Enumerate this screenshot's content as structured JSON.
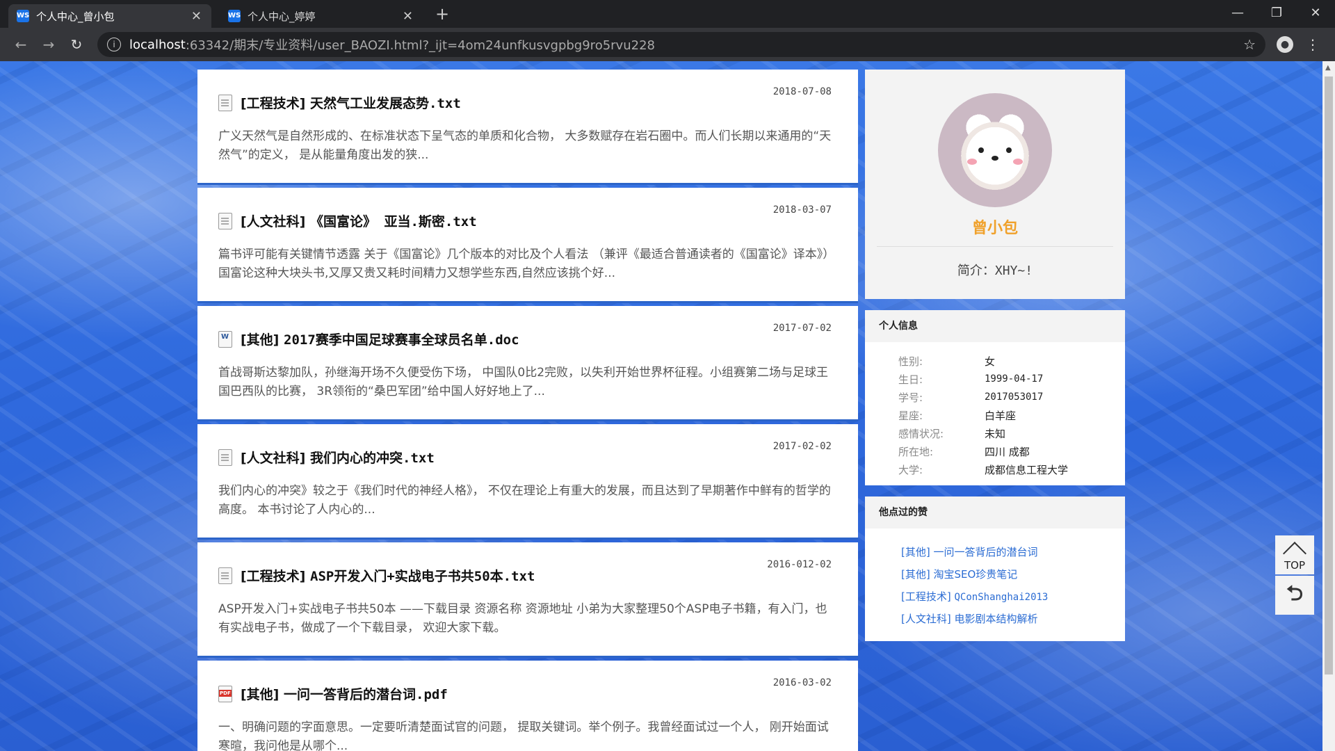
{
  "browser": {
    "tabs": [
      {
        "title": "个人中心_曾小包",
        "favicon": "WS",
        "active": true
      },
      {
        "title": "个人中心_婷婷",
        "favicon": "WS",
        "active": false
      }
    ],
    "url_host": "localhost",
    "url_path": ":63342/期末/专业资料/user_BAOZI.html?_ijt=4om24unfkusvgpbg9ro5rvu228"
  },
  "feed": {
    "items": [
      {
        "date": "2018-07-08",
        "category": "[工程技术]",
        "name": "天然气工业发展态势.txt",
        "filetype": "txt",
        "desc": "广义天然气是自然形成的、在标准状态下呈气态的单质和化合物， 大多数赋存在岩石圈中。而人们长期以来通用的“天然气”的定义， 是从能量角度出发的狭..."
      },
      {
        "date": "2018-03-07",
        "category": "[人文社科]",
        "name": "《国富论》 亚当.斯密.txt",
        "filetype": "txt",
        "desc": "篇书评可能有关键情节透露 关于《国富论》几个版本的对比及个人看法 （兼评《最适合普通读者的《国富论》译本》） 国富论这种大块头书,又厚又贵又耗时间精力又想学些东西,自然应该挑个好..."
      },
      {
        "date": "2017-07-02",
        "category": "[其他]",
        "name": "2017赛季中国足球赛事全球员名单.doc",
        "filetype": "doc",
        "desc": "首战哥斯达黎加队，孙继海开场不久便受伤下场， 中国队0比2完败，以失利开始世界杯征程。小组赛第二场与足球王国巴西队的比赛， 3R领衔的“桑巴军团”给中国人好好地上了..."
      },
      {
        "date": "2017-02-02",
        "category": "[人文社科]",
        "name": "我们内心的冲突.txt",
        "filetype": "txt",
        "desc": "我们内心的冲突》较之于《我们时代的神经人格》， 不仅在理论上有重大的发展，而且达到了早期著作中鲜有的哲学的高度。 本书讨论了人内心的..."
      },
      {
        "date": "2016-012-02",
        "category": "[工程技术]",
        "name": "ASP开发入门+实战电子书共50本.txt",
        "filetype": "txt",
        "desc": "ASP开发入门+实战电子书共50本 ——下载目录 资源名称 资源地址 小弟为大家整理50个ASP电子书籍，有入门，也有实战电子书，做成了一个下载目录， 欢迎大家下载。"
      },
      {
        "date": "2016-03-02",
        "category": "[其他]",
        "name": "一问一答背后的潜台词.pdf",
        "filetype": "pdf",
        "desc": "一、明确问题的字面意思。一定要听清楚面试官的问题， 提取关键词。举个例子。我曾经面试过一个人， 刚开始面试寒暄，我问他是从哪个..."
      }
    ]
  },
  "profile": {
    "name": "曾小包",
    "bio_label": "简介：",
    "bio_value": "XHY~!"
  },
  "personal_info": {
    "header": "个人信息",
    "rows": [
      {
        "k": "性别:",
        "v": "女"
      },
      {
        "k": "生日:",
        "v": "1999-04-17"
      },
      {
        "k": "学号:",
        "v": "2017053017"
      },
      {
        "k": "星座:",
        "v": "白羊座"
      },
      {
        "k": "感情状况:",
        "v": "未知"
      },
      {
        "k": "所在地:",
        "v": "四川 成都"
      },
      {
        "k": "大学:",
        "v": "成都信息工程大学"
      }
    ]
  },
  "likes": {
    "header": "他点过的赞",
    "items": [
      {
        "cat": "[其他]",
        "title": "一问一答背后的潜台词"
      },
      {
        "cat": "[其他]",
        "title": "淘宝SEO珍贵笔记"
      },
      {
        "cat": "[工程技术]",
        "title": "QConShanghai2013"
      },
      {
        "cat": "[人文社科]",
        "title": "电影剧本结构解析"
      }
    ]
  },
  "float": {
    "top_label": "TOP"
  }
}
